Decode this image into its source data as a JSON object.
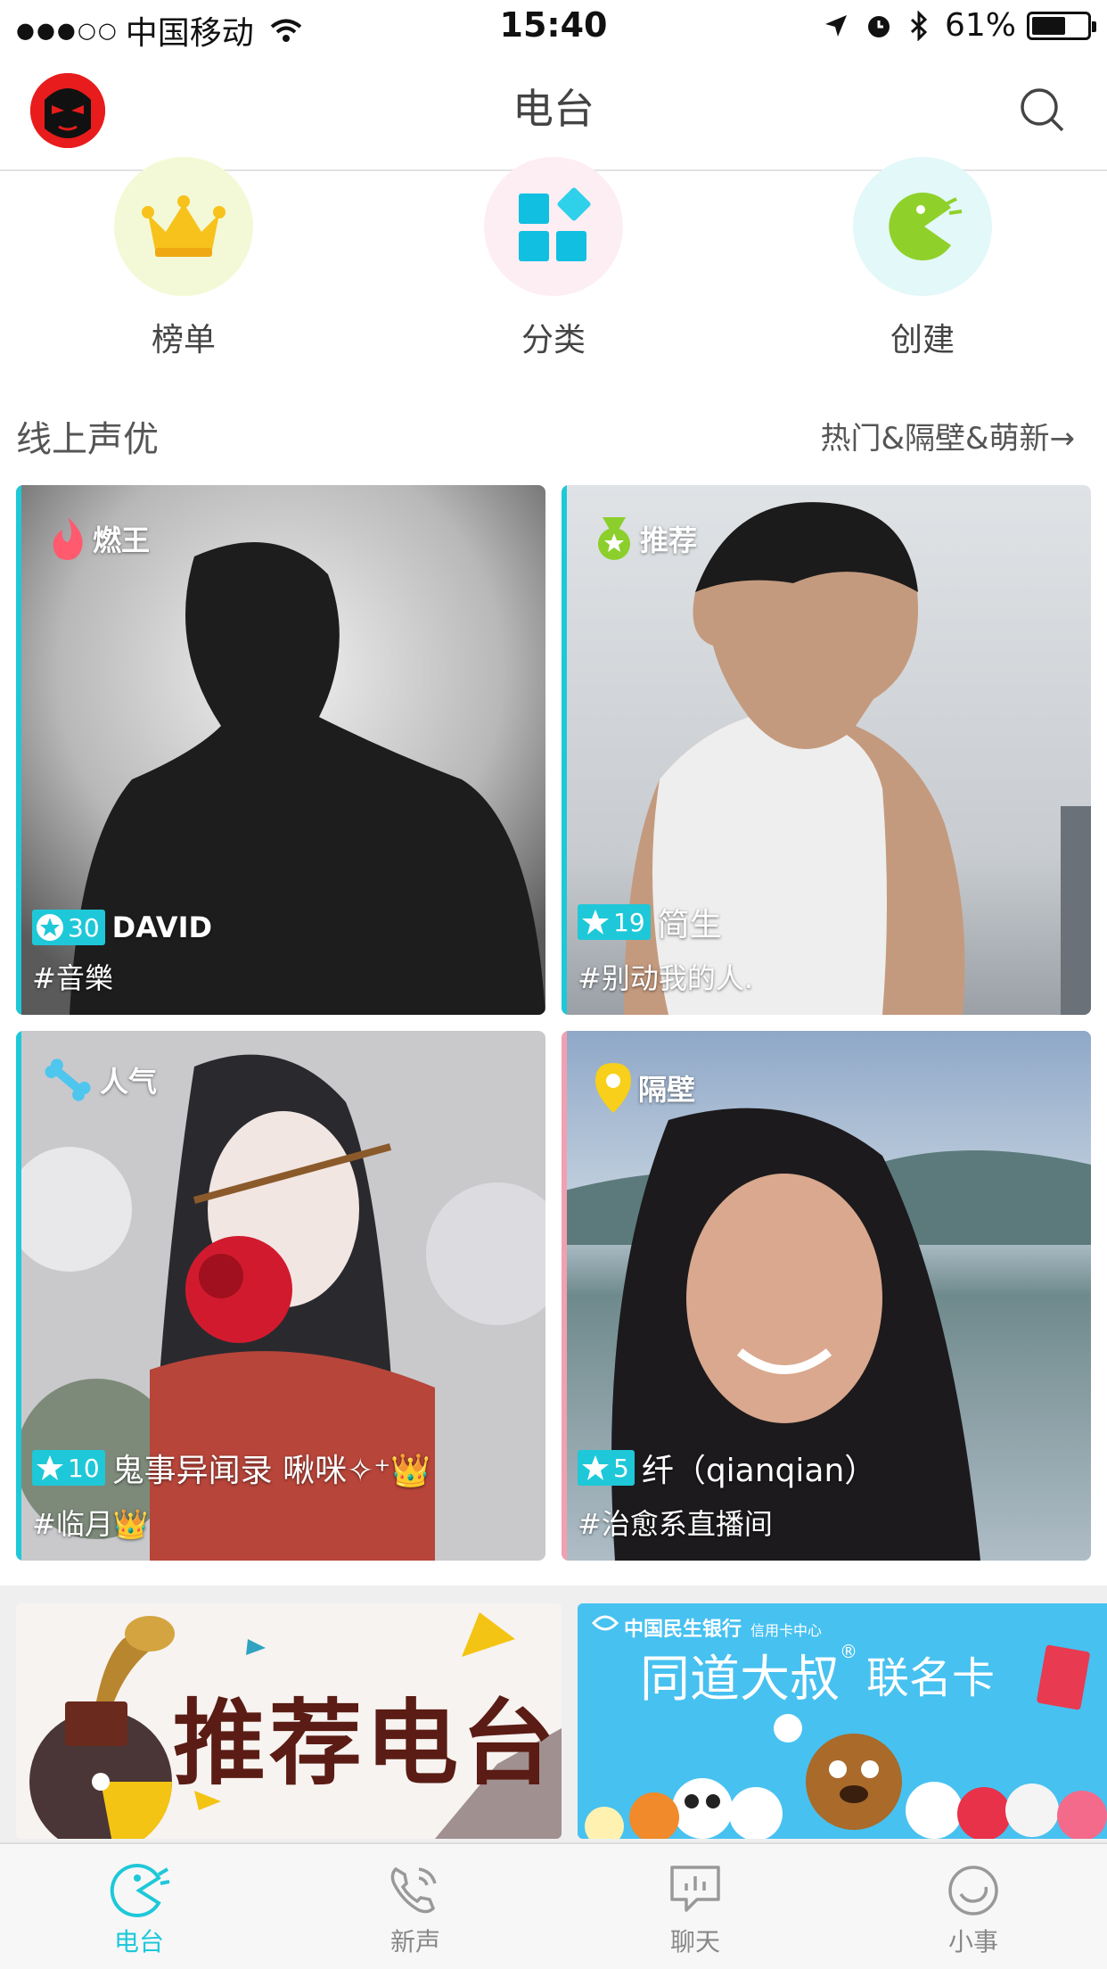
{
  "status_bar": {
    "signal": "●●●○○",
    "carrier": "中国移动",
    "time": "15:40",
    "battery": "61%",
    "battery_level": 0.61
  },
  "nav": {
    "title": "电台"
  },
  "quick_entries": [
    {
      "label": "榜单",
      "icon": "crown-icon",
      "bg": "#f3f9d6"
    },
    {
      "label": "分类",
      "icon": "category-grid-icon",
      "bg": "#fdeef3"
    },
    {
      "label": "创建",
      "icon": "create-pacman-icon",
      "bg": "#e3f8f8"
    }
  ],
  "section": {
    "title": "线上声优",
    "more": "热门&隔壁&萌新→"
  },
  "cards": [
    {
      "tag": "燃王",
      "tag_icon": "flame-icon",
      "level": "30",
      "name": "DAVID",
      "topic": "#音樂",
      "accent": "#1ec8d8"
    },
    {
      "tag": "推荐",
      "tag_icon": "medal-icon",
      "level": "19",
      "name": "简生",
      "topic": "#别动我的人.",
      "accent": "#1ec8d8"
    },
    {
      "tag": "人气",
      "tag_icon": "bone-icon",
      "level": "10",
      "name": "鬼事异闻录  啾咪✧⁺👑",
      "topic": "#临月👑",
      "accent": "#1ec8d8"
    },
    {
      "tag": "隔壁",
      "tag_icon": "location-pin-icon",
      "level": "5",
      "name": "纤（qianqian）",
      "topic": "#治愈系直播间",
      "accent": "#f0a0b0"
    }
  ],
  "banners": [
    {
      "text": "推荐电台"
    },
    {
      "bank": "中国民生银行",
      "bank_sub": "信用卡中心",
      "text": "同道大叔",
      "suffix": "联名卡"
    }
  ],
  "tabs": [
    {
      "label": "电台",
      "icon": "radio-tab-icon",
      "active": true
    },
    {
      "label": "新声",
      "icon": "phone-tab-icon",
      "active": false
    },
    {
      "label": "聊天",
      "icon": "chat-tab-icon",
      "active": false
    },
    {
      "label": "小事",
      "icon": "moments-tab-icon",
      "active": false
    }
  ],
  "colors": {
    "accent": "#1ec8d8"
  }
}
